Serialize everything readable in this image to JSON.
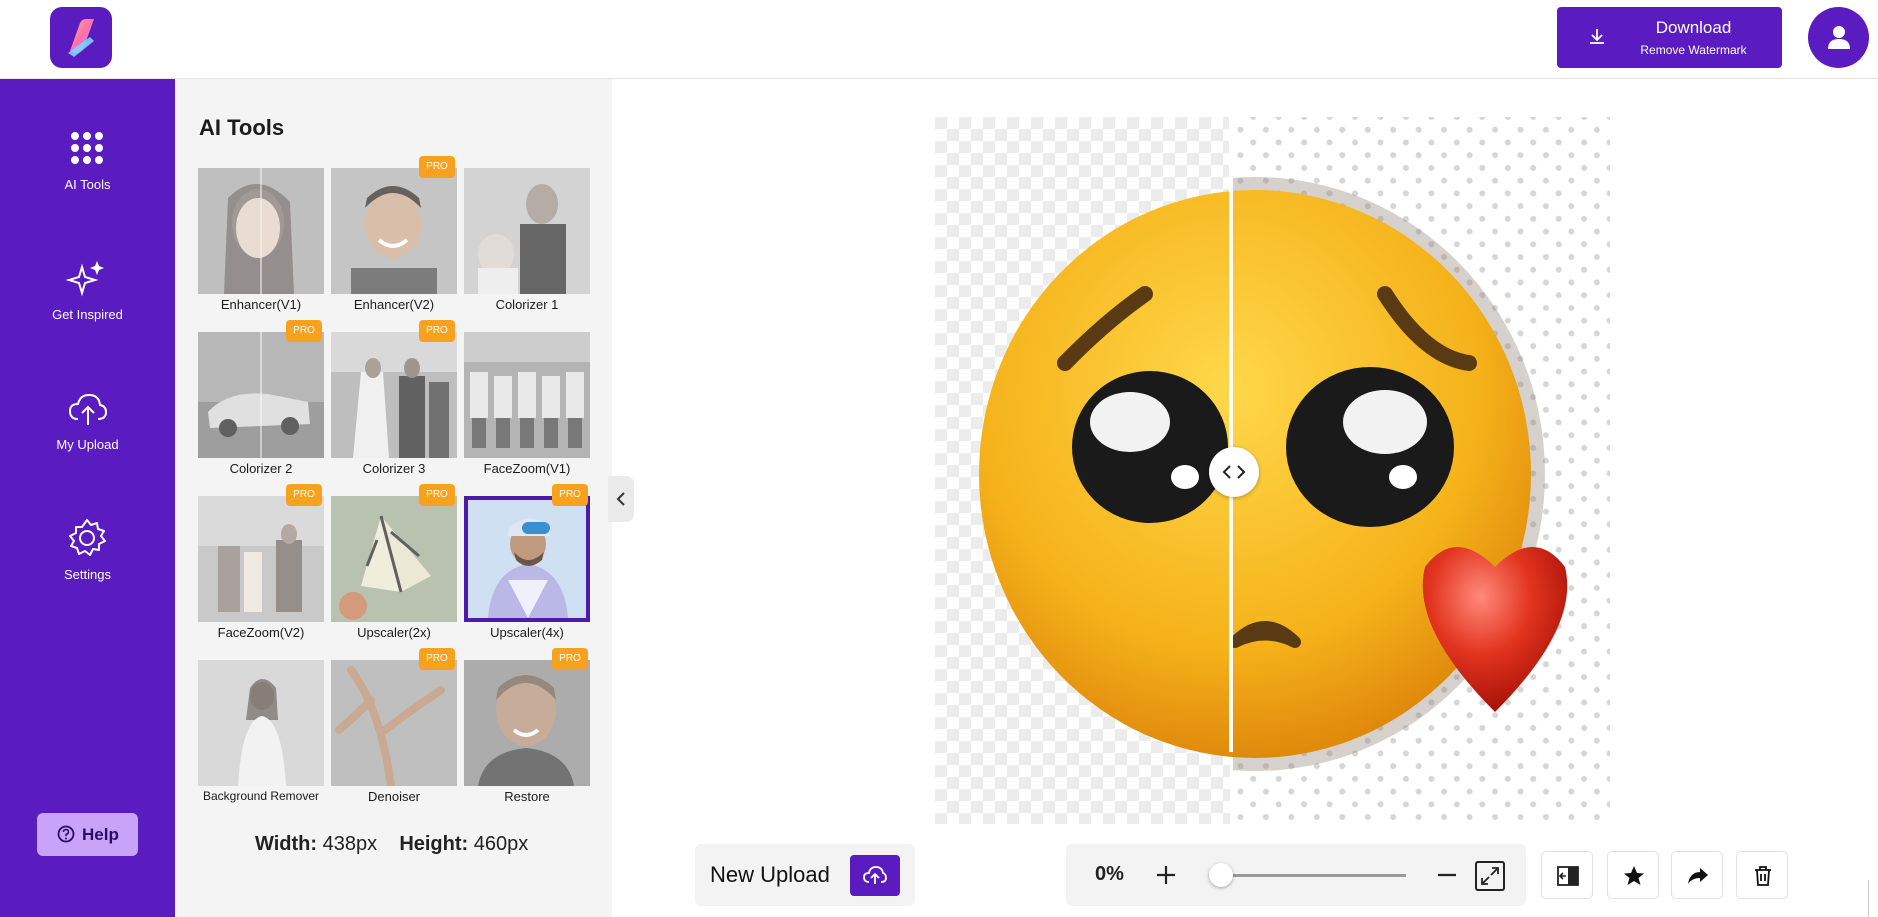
{
  "header": {
    "logo": "app-logo",
    "download_label": "Download",
    "download_sub": "Remove Watermark"
  },
  "sidebar": {
    "items": [
      {
        "label": "AI Tools",
        "icon": "grid-dots-icon"
      },
      {
        "label": "Get Inspired",
        "icon": "sparkles-icon"
      },
      {
        "label": "My Upload",
        "icon": "cloud-upload-icon"
      },
      {
        "label": "Settings",
        "icon": "gear-icon"
      }
    ],
    "help_label": "Help"
  },
  "tools_panel": {
    "title": "AI Tools",
    "pro_label": "PRO",
    "cards": [
      {
        "label": "Enhancer(V1)",
        "pro": false
      },
      {
        "label": "Enhancer(V2)",
        "pro": true
      },
      {
        "label": "Colorizer 1",
        "pro": false
      },
      {
        "label": "Colorizer 2",
        "pro": true
      },
      {
        "label": "Colorizer 3",
        "pro": true
      },
      {
        "label": "FaceZoom(V1)",
        "pro": false
      },
      {
        "label": "FaceZoom(V2)",
        "pro": true
      },
      {
        "label": "Upscaler(2x)",
        "pro": true
      },
      {
        "label": "Upscaler(4x)",
        "pro": true,
        "active": true
      },
      {
        "label": "Background Remover",
        "pro": false
      },
      {
        "label": "Denoiser",
        "pro": true
      },
      {
        "label": "Restore",
        "pro": true
      }
    ],
    "width_label": "Width:",
    "width_value": "438px",
    "height_label": "Height:",
    "height_value": "460px"
  },
  "bottom_bar": {
    "new_upload_label": "New Upload",
    "zoom_percent": "0%",
    "zoom_level": 0
  },
  "colors": {
    "brand": "#5a1cc0",
    "pro_badge": "#f6a21e",
    "help_bg": "#c9a3f7"
  }
}
